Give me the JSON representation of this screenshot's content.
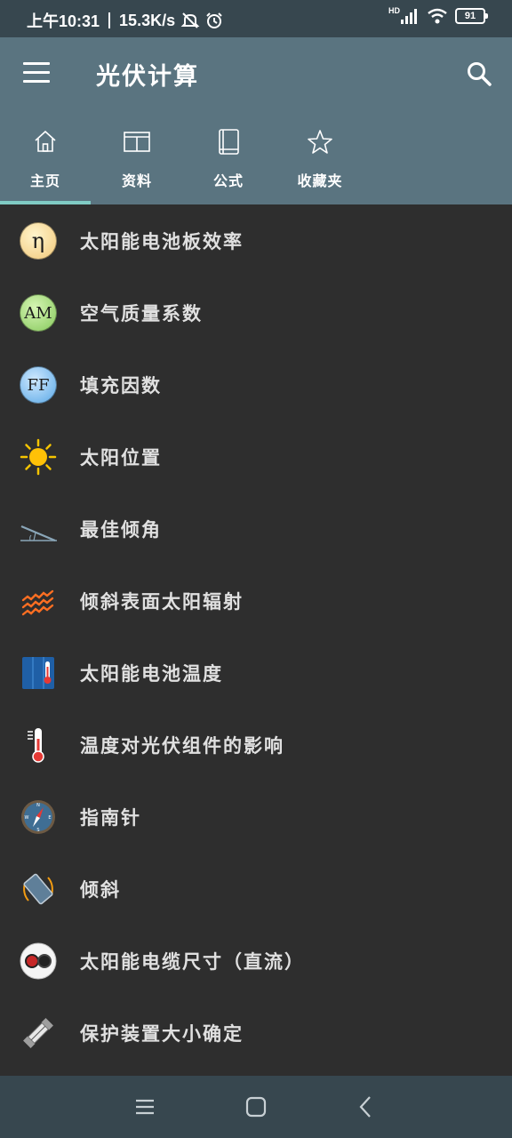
{
  "status": {
    "time": "上午10:31",
    "speed": "15.3K/s",
    "hd": "HD",
    "battery": "91"
  },
  "app": {
    "title": "光伏计算",
    "menu_icon": "hamburger-menu-icon",
    "search_icon": "search-icon"
  },
  "tabs": [
    {
      "label": "主页",
      "icon": "home-icon",
      "active": true
    },
    {
      "label": "资料",
      "icon": "table-icon",
      "active": false
    },
    {
      "label": "公式",
      "icon": "book-icon",
      "active": false
    },
    {
      "label": "收藏夹",
      "icon": "star-icon",
      "active": false
    }
  ],
  "items": [
    {
      "label": "太阳能电池板效率",
      "icon": "eta-icon",
      "icon_text": "η"
    },
    {
      "label": "空气质量系数",
      "icon": "air-mass-icon",
      "icon_text": "AM"
    },
    {
      "label": "填充因数",
      "icon": "fill-factor-icon",
      "icon_text": "FF"
    },
    {
      "label": "太阳位置",
      "icon": "sun-icon"
    },
    {
      "label": "最佳倾角",
      "icon": "tilt-angle-icon"
    },
    {
      "label": "倾斜表面太阳辐射",
      "icon": "radiation-icon"
    },
    {
      "label": "太阳能电池温度",
      "icon": "panel-thermometer-icon"
    },
    {
      "label": "温度对光伏组件的影响",
      "icon": "thermometer-icon"
    },
    {
      "label": "指南针",
      "icon": "compass-icon"
    },
    {
      "label": "倾斜",
      "icon": "inclination-icon"
    },
    {
      "label": "太阳能电缆尺寸（直流）",
      "icon": "cable-icon"
    },
    {
      "label": "保护装置大小确定",
      "icon": "fuse-icon"
    }
  ],
  "colors": {
    "statusbar": "#37474f",
    "appbar": "#5a7480",
    "background": "#2e2e2e",
    "tab_indicator": "#80cbc4"
  }
}
